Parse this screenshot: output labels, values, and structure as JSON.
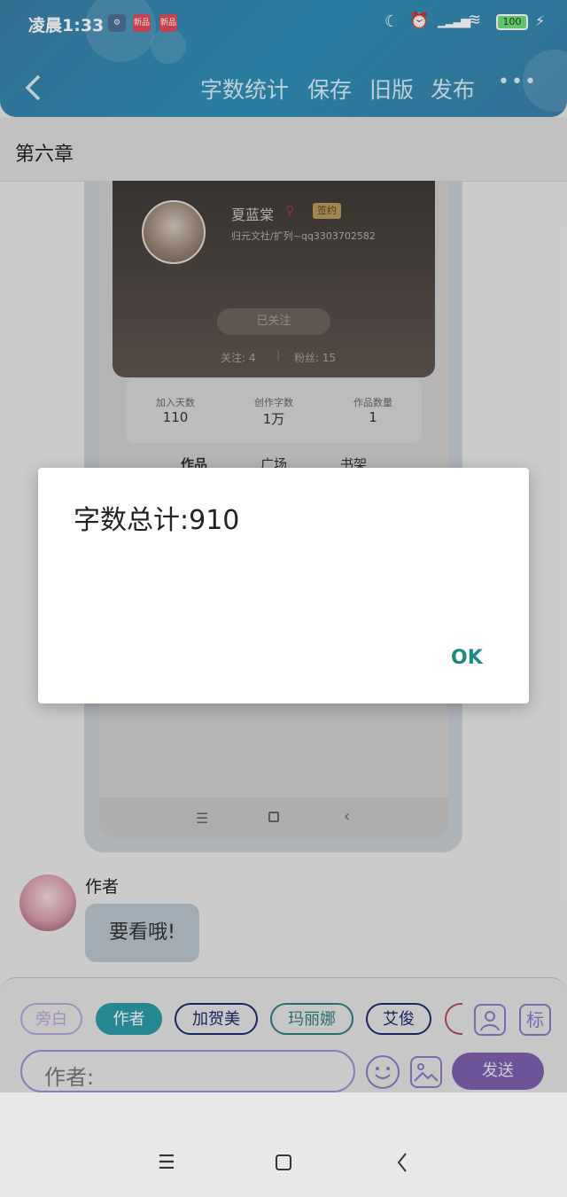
{
  "status_bar": {
    "time": "凌晨1:33",
    "app_icon_1": "新品",
    "app_icon_2": "新品",
    "battery": "100"
  },
  "toolbar": {
    "word_count": "字数统计",
    "save": "保存",
    "old_version": "旧版",
    "publish": "发布",
    "more": "•••"
  },
  "chapter": {
    "title": "第六章"
  },
  "profile": {
    "name": "夏蓝棠",
    "badge": "签约",
    "subtitle": "归元文社/扩列~qq3303702582",
    "follow_button": "已关注",
    "following": "关注: 4",
    "followers": "粉丝: 15",
    "stats": [
      {
        "label": "加入天数",
        "value": "110"
      },
      {
        "label": "创作字数",
        "value": "1万"
      },
      {
        "label": "作品数量",
        "value": "1"
      }
    ],
    "tabs": [
      "作品",
      "广场",
      "书架"
    ]
  },
  "chat": {
    "author": "作者",
    "message": "要看哦!"
  },
  "roles": [
    "旁白",
    "作者",
    "加贺美",
    "玛丽娜",
    "艾俊"
  ],
  "role_colors": [
    "#b9a2dd",
    "#2a9aa6",
    "#1c2c6c",
    "#2f7f7f",
    "#1c2c6c"
  ],
  "side_icons": {
    "mark": "标"
  },
  "input": {
    "label": "作者:"
  },
  "send": {
    "label": "发送"
  },
  "dialog": {
    "message": "字数总计:910",
    "ok": "OK"
  },
  "colors": {
    "accent": "#2f8fb8",
    "purple": "#7e5faf",
    "ok": "#1d8a82"
  }
}
